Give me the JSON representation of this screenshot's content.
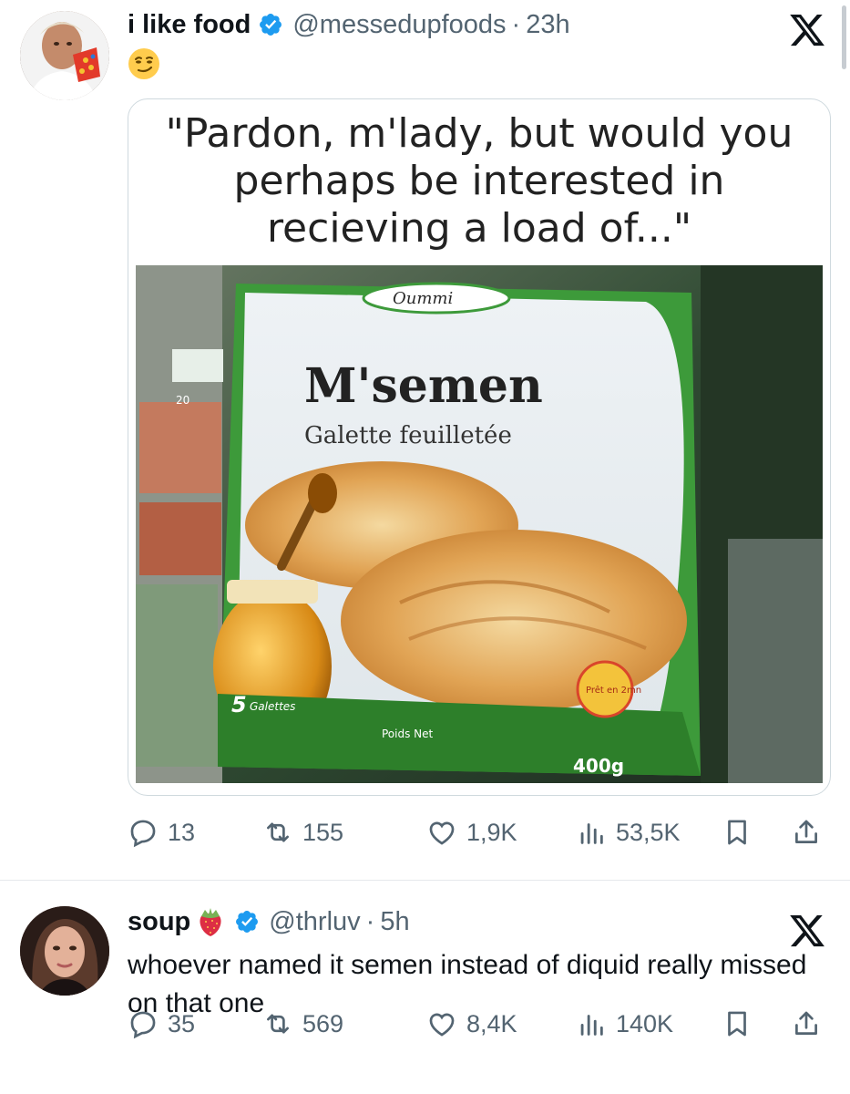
{
  "tweet1": {
    "author_name": "i like food",
    "handle": "@messedupfoods",
    "separator": "·",
    "time": "23h",
    "text_emoji": "smirking-face",
    "media": {
      "caption": "\"Pardon, m'lady, but would you perhaps be interested in recieving a load of...\"",
      "package_brand": "Oummi",
      "package_title": "M'semen",
      "package_subtitle": "Galette feuilletée",
      "package_count": "5",
      "package_count_label": "Galettes",
      "package_weight_label": "Poids Net",
      "package_weight": "400g",
      "package_badge": "Prêt en 2mn",
      "shelf_tag": "20"
    },
    "stats": {
      "replies": "13",
      "reposts": "155",
      "likes": "1,9K",
      "views": "53,5K"
    }
  },
  "tweet2": {
    "author_name": "soup",
    "name_emoji": "strawberry",
    "handle": "@thrluv",
    "separator": "·",
    "time": "5h",
    "text": "whoever named it semen instead of diquid really missed on that one",
    "stats": {
      "replies": "35",
      "reposts": "569",
      "likes": "8,4K",
      "views": "140K"
    }
  },
  "colors": {
    "verified_blue": "#1d9bf0",
    "secondary_text": "#536471",
    "primary_text": "#0f1419"
  }
}
